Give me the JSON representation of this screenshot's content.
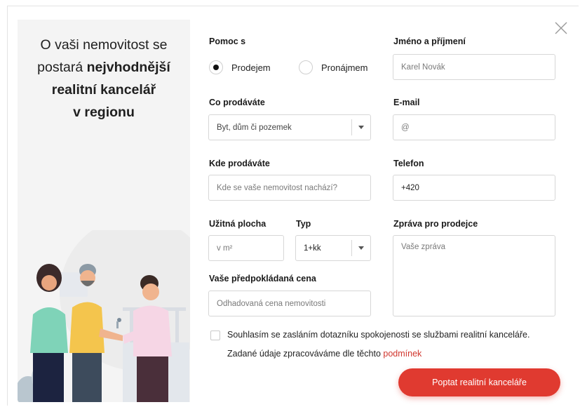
{
  "headline": {
    "line1": "O vaši nemovitost se",
    "line2_pre": "postará ",
    "line2_bold": "nejvhodnější",
    "line3_bold": "realitní kancelář",
    "line4_bold": "v regionu"
  },
  "help": {
    "label": "Pomoc s",
    "options": [
      {
        "label": "Prodejem",
        "selected": true
      },
      {
        "label": "Pronájmem",
        "selected": false
      }
    ]
  },
  "what": {
    "label": "Co prodáváte",
    "value": "Byt, dům či pozemek"
  },
  "where": {
    "label": "Kde prodáváte",
    "placeholder": "Kde se vaše nemovitost nachází?"
  },
  "area": {
    "label": "Užitná plocha",
    "placeholder": "v m²"
  },
  "type": {
    "label": "Typ",
    "value": "1+kk"
  },
  "price": {
    "label": "Vaše předpokládaná cena",
    "placeholder": "Odhadovaná cena nemovitosti"
  },
  "name": {
    "label": "Jméno a příjmení",
    "placeholder": "Karel Novák"
  },
  "email": {
    "label": "E-mail",
    "placeholder": "@"
  },
  "phone": {
    "label": "Telefon",
    "value": "+420"
  },
  "message": {
    "label": "Zpráva pro prodejce",
    "placeholder": "Vaše zpráva"
  },
  "consent": {
    "label": "Souhlasím se zasláním dotazníku spokojenosti se službami realitní kanceláře.",
    "checked": false
  },
  "terms": {
    "text": "Zadané údaje zpracováváme dle těchto ",
    "link": "podmínek"
  },
  "submit": {
    "label": "Poptat realitní kanceláře"
  },
  "colors": {
    "accent": "#e03a30",
    "link": "#d0352c",
    "panel": "#f4f4f4"
  }
}
